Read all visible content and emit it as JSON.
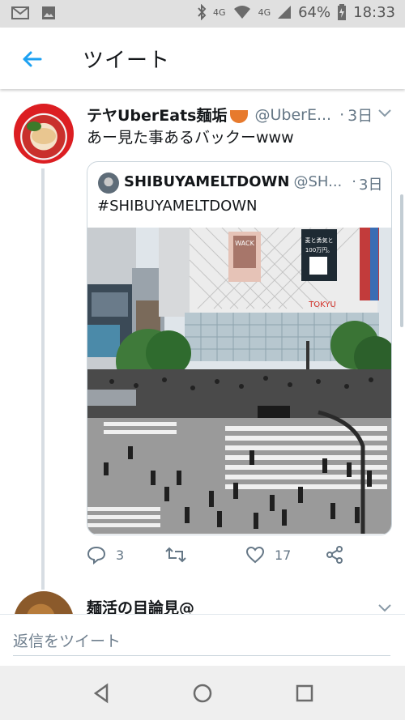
{
  "status_bar": {
    "network": "4G",
    "network2": "4G",
    "battery": "64%",
    "time": "18:33"
  },
  "header": {
    "back_label": "←",
    "title": "ツイート"
  },
  "tweet": {
    "name": "テヤUberEats麺垢",
    "handle": "@UberE...",
    "dot": "·",
    "time": "3日",
    "text": "あー見た事あるバックーwww",
    "quote": {
      "name": "SHIBUYAMELTDOWN",
      "handle": "@SH...",
      "dot": "·",
      "time": "3日",
      "text": "#SHIBUYAMELTDOWN",
      "image_signs": {
        "store": "TOKYU",
        "billboard": "麦と勇気と100万円。",
        "billboard2": "WACK"
      }
    },
    "actions": {
      "reply_count": "3",
      "retweet_count": "",
      "like_count": "17"
    }
  },
  "next_tweet": {
    "name": "麺活の目論見@"
  },
  "reply": {
    "placeholder": "返信をツイート"
  },
  "colors": {
    "accent": "#1da1f2",
    "text": "#14171a",
    "muted": "#657786",
    "border": "#ccd6dd"
  },
  "icons": [
    "email-icon",
    "image-icon",
    "bluetooth-icon",
    "wifi-icon",
    "signal-icon",
    "battery-icon",
    "back-arrow-icon",
    "chevron-down-icon",
    "reply-icon",
    "retweet-icon",
    "like-icon",
    "share-icon",
    "nav-back-icon",
    "nav-home-icon",
    "nav-recents-icon"
  ]
}
